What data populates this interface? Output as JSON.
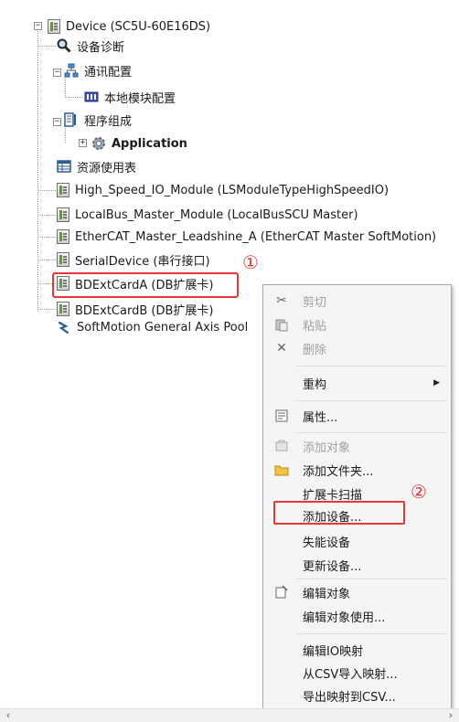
{
  "tree": {
    "device": "Device (SC5U-60E16DS)",
    "diagnostics": "设备诊断",
    "comm_config": "通讯配置",
    "local_module_config": "本地模块配置",
    "program_group": "程序组成",
    "application": "Application",
    "resource_usage": "资源使用表",
    "high_speed_io": "High_Speed_IO_Module (LSModuleTypeHighSpeedIO)",
    "localbus_master": "LocalBus_Master_Module (LocalBusSCU Master)",
    "ethercat_master": "EtherCAT_Master_Leadshine_A (EtherCAT Master SoftMotion)",
    "serial_device": "SerialDevice (串行接口)",
    "bdext_a": "BDExtCardA (DB扩展卡)",
    "bdext_b": "BDExtCardB (DB扩展卡)",
    "softmotion_pool": "SoftMotion General Axis Pool"
  },
  "annotations": {
    "marker1": "①",
    "marker2": "②",
    "color": "#e53935"
  },
  "context_menu": {
    "items": [
      {
        "label": "剪切",
        "icon": "scissors-icon",
        "enabled": false
      },
      {
        "label": "粘贴",
        "icon": "paste-icon",
        "enabled": false
      },
      {
        "label": "删除",
        "icon": "delete-x-icon",
        "enabled": false
      },
      {
        "label": "重构",
        "has_submenu": true,
        "enabled": true
      },
      {
        "label": "属性...",
        "icon": "properties-icon",
        "enabled": true
      },
      {
        "label": "添加对象",
        "icon": "add-object-icon",
        "enabled": false
      },
      {
        "label": "添加文件夹...",
        "icon": "folder-icon",
        "enabled": true
      },
      {
        "label": "扩展卡扫描",
        "enabled": true
      },
      {
        "label": "添加设备...",
        "enabled": true
      },
      {
        "label": "失能设备",
        "enabled": true
      },
      {
        "label": "更新设备...",
        "enabled": true
      },
      {
        "label": "编辑对象",
        "icon": "edit-object-icon",
        "enabled": true
      },
      {
        "label": "编辑对象使用...",
        "enabled": true
      },
      {
        "label": "编辑IO映射",
        "enabled": true
      },
      {
        "label": "从CSV导入映射...",
        "enabled": true
      },
      {
        "label": "导出映射到CSV...",
        "enabled": true
      }
    ]
  },
  "scrollbar": {
    "left_arrow": "‹",
    "right_arrow": "›"
  }
}
